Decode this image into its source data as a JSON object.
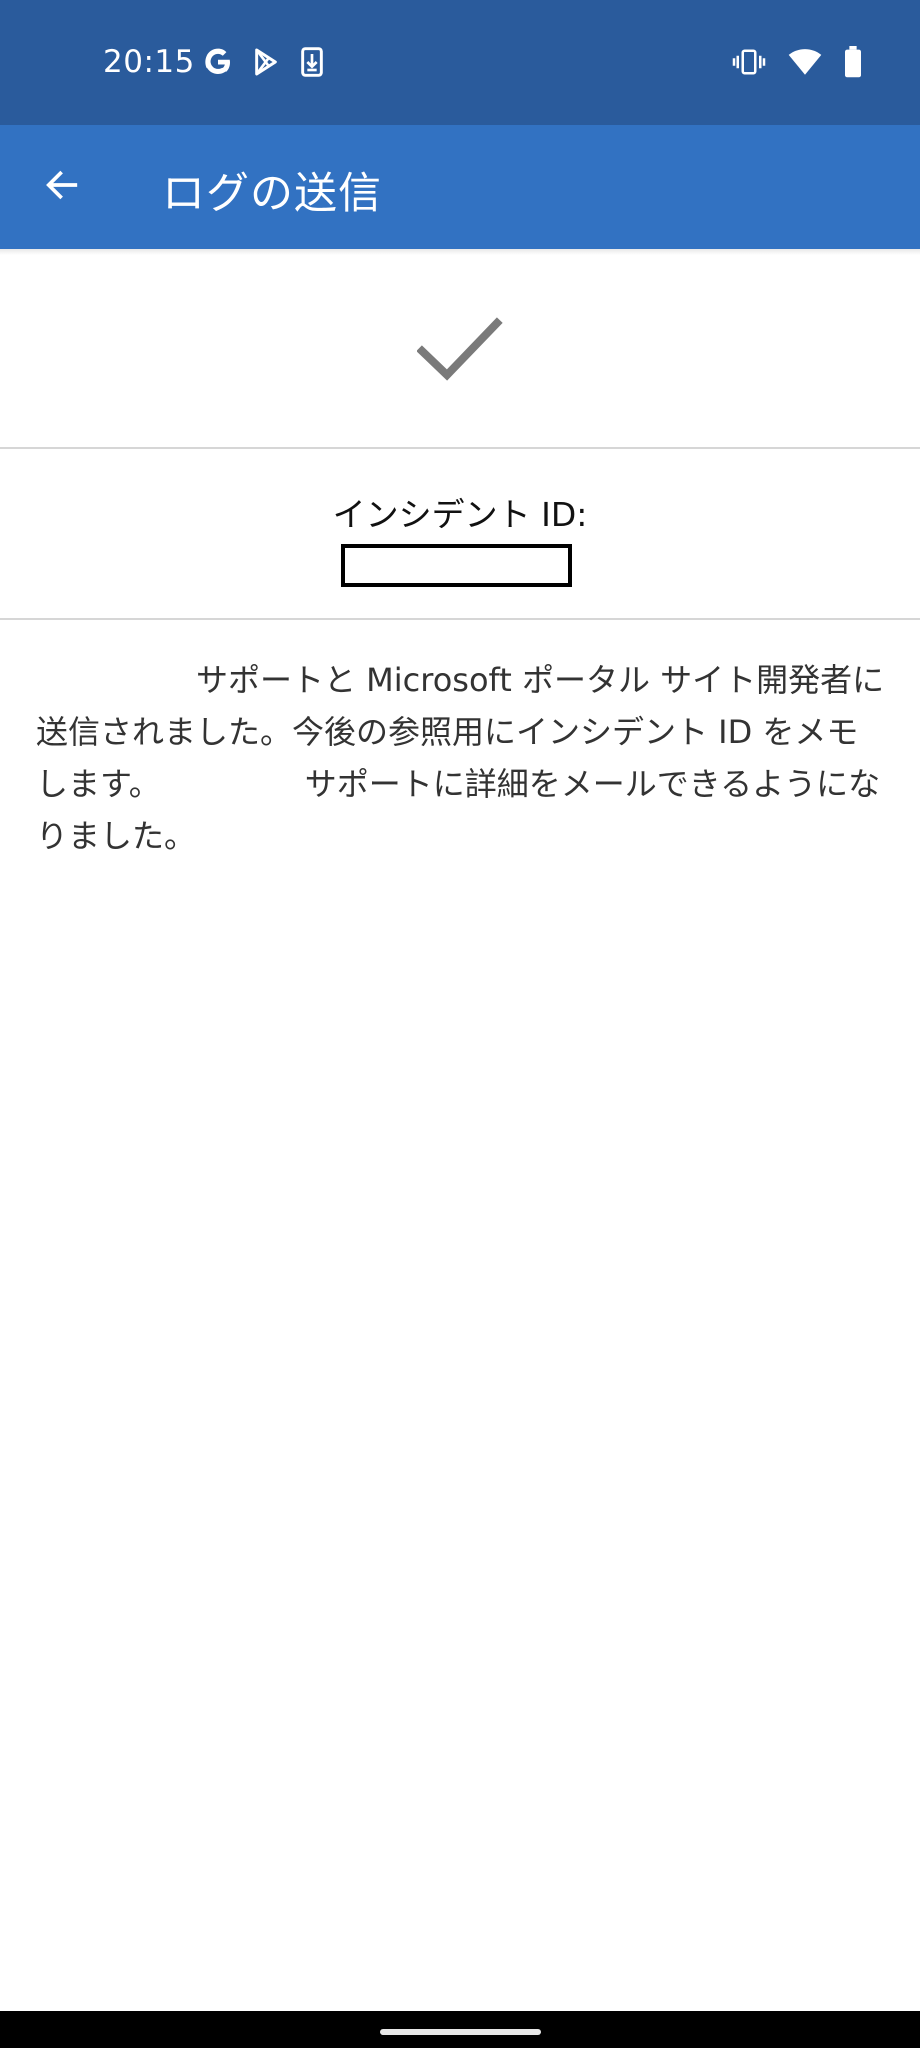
{
  "status_bar": {
    "time": "20:15",
    "left_icons": [
      "google-icon",
      "play-store-icon",
      "download-icon"
    ],
    "right_icons": [
      "vibrate-icon",
      "wifi-icon",
      "battery-icon"
    ]
  },
  "app_bar": {
    "title": "ログの送信",
    "back_icon": "arrow-left-icon",
    "color": "#3272c2"
  },
  "status_color": "#2a5b9c",
  "success_icon": "checkmark-icon",
  "incident": {
    "label": "インシデント ID:",
    "value": ""
  },
  "message": "　　　　　サポートと Microsoft ポータル サイト開発者に送信されました。今後の参照用にインシデント ID をメモします。　　　　　サポートに詳細をメールできるようになりました。"
}
